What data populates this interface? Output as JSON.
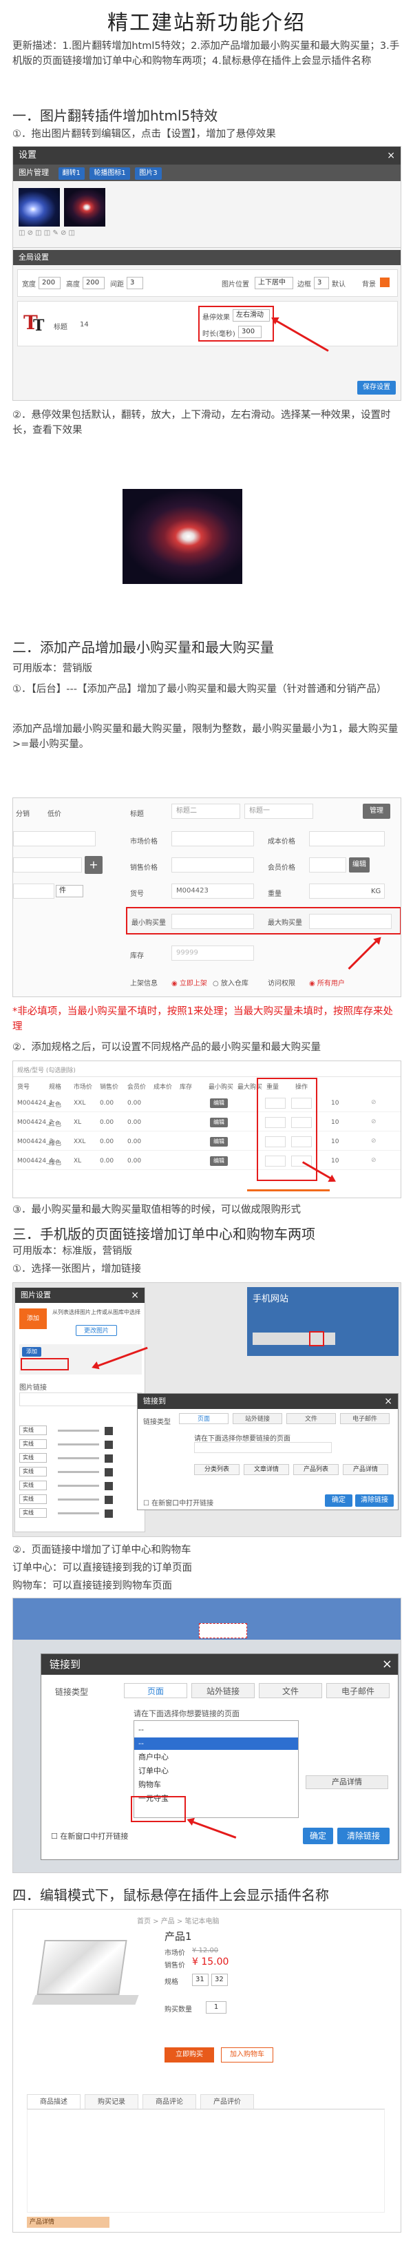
{
  "doc": {
    "title": "精工建站新功能介绍",
    "intro": "更新描述：1.图片翻转增加html5特效；2.添加产品增加最小购买量和最大购买量；3.手机版的页面链接增加订单中心和购物车两项；4.鼠标悬停在插件上会显示插件名称",
    "s1_title": "一．图片翻转插件增加html5特效",
    "s1_step1": "①．拖出图片翻转到编辑区，点击【设置】，增加了悬停效果",
    "s1_step2": "②．悬停效果包括默认，翻转，放大，上下滑动，左右滑动。选择某一种效果，设置时长，查看下效果",
    "s2_title": "二．添加产品增加最小购买量和最大购买量",
    "s2_version": "可用版本：营销版",
    "s2_step1": "①．【后台】---【添加产品】增加了最小购买量和最大购买量（针对普通和分销产品）",
    "s2_desc": "添加产品增加最小购买量和最大购买量，限制为整数，最小购买量最小为1，最大购买量>=最小购买量。",
    "s2_warning": "*非必填项，当最小购买量不填时，按照1来处理；当最大购买量未填时，按照库存来处理",
    "s2_step2": "②．添加规格之后，可以设置不同规格产品的最小购买量和最大购买量",
    "s2_step3": "③．最小购买量和最大购买量取值相等的时候，可以做成限购形式",
    "s3_title": "三．手机版的页面链接增加订单中心和购物车两项",
    "s3_version": "可用版本：标准版，营销版",
    "s3_step1": "①．选择一张图片，增加链接",
    "s3_step2": "②．页面链接中增加了订单中心和购物车",
    "s3_order": "订单中心：可以直接链接到我的订单页面",
    "s3_cart": "购物车：可以直接链接到购物车页面",
    "s4_title": "四．编辑模式下，鼠标悬停在插件上会显示插件名称"
  },
  "shot1": {
    "header": "设置",
    "tab_label": "图片管理",
    "chip1": "翻转1",
    "chip2": "轮播图标1",
    "chip3": "图片3",
    "global": "全局设置",
    "w_label": "宽度",
    "w_val": "200",
    "h_label": "高度",
    "h_val": "200",
    "gap_label": "间距",
    "gap_val": "3",
    "pos_label": "图片位置",
    "pos_val": "上下居中",
    "border_label": "边框",
    "border_val": "3",
    "default_label": "默认",
    "bg_label": "背景",
    "title_label": "标题",
    "size_val": "14",
    "hover_label": "悬停效果",
    "hover_val": "左右滑动",
    "dur_label": "时长(毫秒)",
    "dur_val": "300",
    "save": "保存设置"
  },
  "shot2": {
    "dist_opt": "分销",
    "normal_opt": "低价",
    "label_title": "标题",
    "label_title2": "标题二",
    "label_title3": "标题一",
    "manage": "管理",
    "market_price": "市场价格",
    "cost_price": "成本价格",
    "sale_price": "销售价格",
    "member_price": "会员价格",
    "edit": "编辑",
    "code_label": "货号",
    "code_val": "M004423",
    "weight_label": "重量",
    "weight_unit": "KG",
    "min_label": "最小购买量",
    "max_label": "最大购买量",
    "stock_label": "库存",
    "stock_val": "99999",
    "status_label": "上架信息",
    "status_opt1": "立即上架",
    "status_opt2": "放入仓库",
    "access_label": "访问权限",
    "access_opt": "所有用户",
    "unit_opt": "件",
    "plus": "+"
  },
  "shot3": {
    "title": "规格/型号 (勾选删除)",
    "headers": [
      "货号",
      "规格",
      "市场价",
      "销售价",
      "会员价",
      "成本价",
      "库存",
      "最小购买",
      "最大购买",
      "重量",
      "操作"
    ],
    "rows": [
      {
        "code": "M004424_1",
        "spec": "红色",
        "size": "XXL",
        "price": "0.00"
      },
      {
        "code": "M004424_2",
        "spec": "红色",
        "size": "XL",
        "price": "0.00"
      },
      {
        "code": "M004424_3",
        "spec": "绿色",
        "size": "XXL",
        "price": "0.00"
      },
      {
        "code": "M004424_4",
        "spec": "绿色",
        "size": "XL",
        "price": "0.00"
      }
    ],
    "edit": "编辑",
    "stock": "10"
  },
  "shot4": {
    "panel_title": "图片设置",
    "panel_hint": "从列表选择图片上传或从图库中选择",
    "add_link": "更改图片",
    "upload": "添加",
    "link_label": "图片链接",
    "phone_title": "手机网站",
    "link_dialog": "链接到",
    "link_type": "链接类型",
    "tabs": [
      "页面",
      "站外链接",
      "文件",
      "电子邮件"
    ],
    "select_hint": "请在下面选择你想要链接的页面",
    "btn_list": [
      "分类列表",
      "文章详情",
      "产品列表",
      "产品详情"
    ],
    "new_window": "在新窗口中打开链接",
    "confirm": "确定",
    "clear": "清除链接"
  },
  "shot5": {
    "dialog_title": "链接到",
    "link_type": "链接类型",
    "tabs": [
      "页面",
      "站外链接",
      "文件",
      "电子邮件"
    ],
    "select_hint": "请在下面选择你想要链接的页面",
    "options": [
      "--",
      "--",
      "商户中心",
      "订单中心",
      "购物车",
      "一元夺宝"
    ],
    "detail_btn": "产品详情",
    "new_window": "在新窗口中打开链接",
    "confirm": "确定",
    "clear": "清除链接",
    "close": "×"
  },
  "shot6": {
    "breadcrumb": "首页 > 产品 > 笔记本电脑",
    "product": "产品1",
    "market_label": "市场价",
    "market_val": "¥ 12.00",
    "price_label": "销售价",
    "price_val": "¥ 15.00",
    "spec_label": "规格",
    "qty_label": "购买数量",
    "qty_val": "1",
    "buy": "立即购买",
    "cart": "加入购物车",
    "tabs": [
      "商品描述",
      "购买记录",
      "商品评论",
      "产品评价"
    ],
    "hover_tip": "产品详情"
  }
}
